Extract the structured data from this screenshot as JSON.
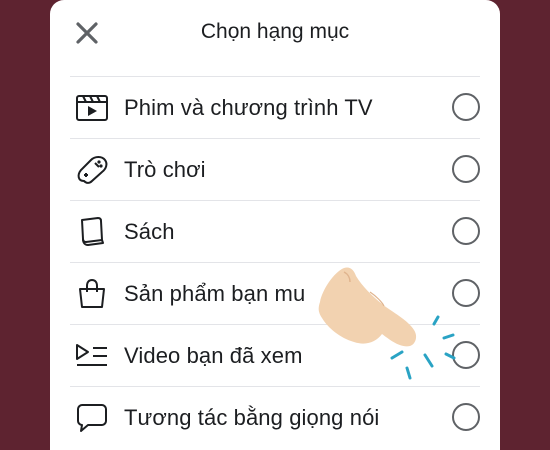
{
  "dialog": {
    "title": "Chọn hạng mục",
    "close_icon": "close-icon"
  },
  "categories": [
    {
      "label": "Phim và chương trình TV",
      "icon": "film-icon",
      "selected": false
    },
    {
      "label": "Trò chơi",
      "icon": "gamepad-icon",
      "selected": false
    },
    {
      "label": "Sách",
      "icon": "book-icon",
      "selected": false
    },
    {
      "label": "Sản phẩm bạn mu",
      "icon": "shopping-bag-icon",
      "selected": false
    },
    {
      "label": "Video bạn đã xem",
      "icon": "video-list-icon",
      "selected": false
    },
    {
      "label": "Tương tác bằng giọng nói",
      "icon": "speech-bubble-icon",
      "selected": false
    }
  ],
  "colors": {
    "background": "#5e2330",
    "sheet": "#ffffff",
    "text": "#1c1e21",
    "tap_indicator": "#2aa3c4",
    "hand": "#f2d2b0"
  }
}
